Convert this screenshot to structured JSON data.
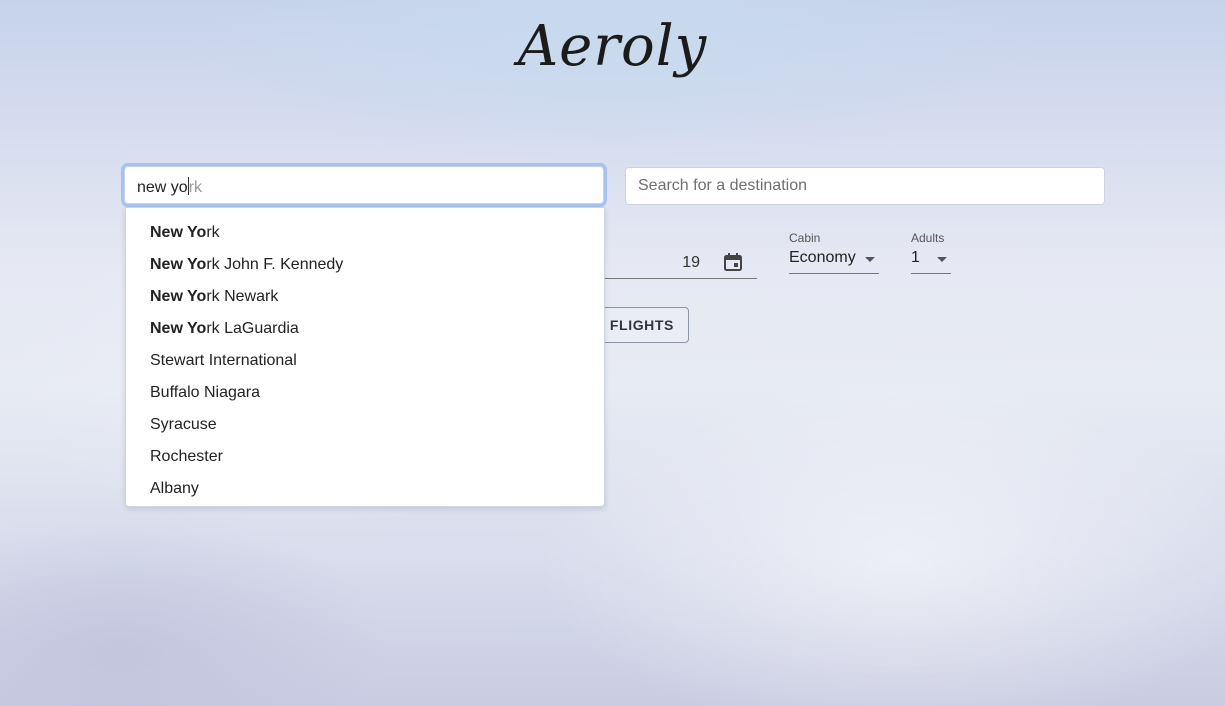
{
  "brand": {
    "logo_text": "Aeroly"
  },
  "origin": {
    "typed_text": "new yo",
    "hint_text": "rk"
  },
  "destination": {
    "placeholder": "Search for a destination"
  },
  "date": {
    "visible_value": "19"
  },
  "cabin": {
    "label": "Cabin",
    "value": "Economy"
  },
  "adults": {
    "label": "Adults",
    "value": "1"
  },
  "search_button": {
    "visible_label": "H FLIGHTS"
  },
  "suggestions": [
    {
      "match": "New Yo",
      "rest": "rk"
    },
    {
      "match": "New Yo",
      "rest": "rk John F. Kennedy"
    },
    {
      "match": "New Yo",
      "rest": "rk Newark"
    },
    {
      "match": "New Yo",
      "rest": "rk LaGuardia"
    },
    {
      "match": "",
      "rest": "Stewart International"
    },
    {
      "match": "",
      "rest": "Buffalo Niagara"
    },
    {
      "match": "",
      "rest": "Syracuse"
    },
    {
      "match": "",
      "rest": "Rochester"
    },
    {
      "match": "",
      "rest": "Albany"
    }
  ],
  "icons": {
    "date": "calendar-icon",
    "select": "caret-down-icon"
  }
}
